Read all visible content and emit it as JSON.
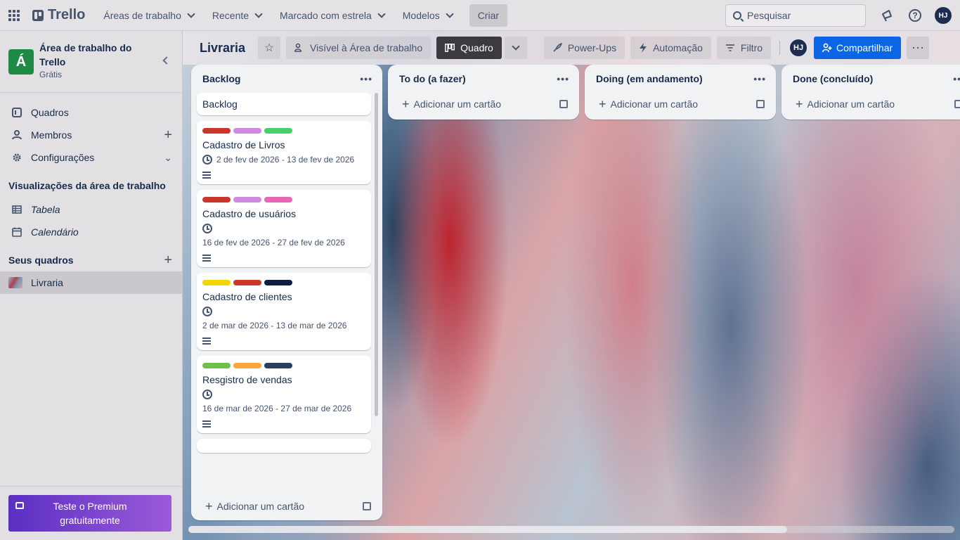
{
  "topbar": {
    "logo": "Trello",
    "nav": [
      "Áreas de trabalho",
      "Recente",
      "Marcado com estrela",
      "Modelos"
    ],
    "create": "Criar",
    "search_placeholder": "Pesquisar",
    "user_initials": "HJ"
  },
  "sidebar": {
    "workspace_initial": "Á",
    "workspace_name": "Área de trabalho do Trello",
    "workspace_plan": "Grátis",
    "items": [
      {
        "label": "Quadros"
      },
      {
        "label": "Membros"
      },
      {
        "label": "Configurações"
      }
    ],
    "views_heading": "Visualizações da área de trabalho",
    "views": [
      {
        "label": "Tabela"
      },
      {
        "label": "Calendário"
      }
    ],
    "boards_heading": "Seus quadros",
    "boards": [
      {
        "label": "Livraria"
      }
    ],
    "premium": "Teste o Premium gratuitamente"
  },
  "board": {
    "title": "Livraria",
    "visibility": "Visível à Área de trabalho",
    "view": "Quadro",
    "powerups": "Power-Ups",
    "automation": "Automação",
    "filter": "Filtro",
    "member_initials": "HJ",
    "share": "Compartilhar"
  },
  "lists": [
    {
      "title": "Backlog",
      "add_card": "Adicionar um cartão",
      "cards": [
        {
          "title": "Backlog"
        },
        {
          "title": "Cadastro de Livros",
          "labels": [
            "#c9372c",
            "#d08be0",
            "#4bce6e"
          ],
          "date": "2 de fev de 2026 - 13 de fev de 2026"
        },
        {
          "title": "Cadastro de usuários",
          "labels": [
            "#c9372c",
            "#d08be0",
            "#e766b5"
          ],
          "date": "16 de fev de 2026 - 27 de fev de 2026"
        },
        {
          "title": "Cadastro de clientes",
          "labels": [
            "#f2d600",
            "#c9372c",
            "#0b1d43"
          ],
          "date": "2 de mar de 2026 - 13 de mar de 2026"
        },
        {
          "title": "Resgistro de vendas",
          "labels": [
            "#6cc04a",
            "#faa53d",
            "#2c3e5d"
          ],
          "date": "16 de mar de 2026 - 27 de mar de 2026"
        }
      ]
    },
    {
      "title": "To do (a fazer)",
      "add_card": "Adicionar um cartão"
    },
    {
      "title": "Doing (em andamento)",
      "add_card": "Adicionar um cartão"
    },
    {
      "title": "Done (concluído)",
      "add_card": "Adicionar um cartão"
    }
  ]
}
